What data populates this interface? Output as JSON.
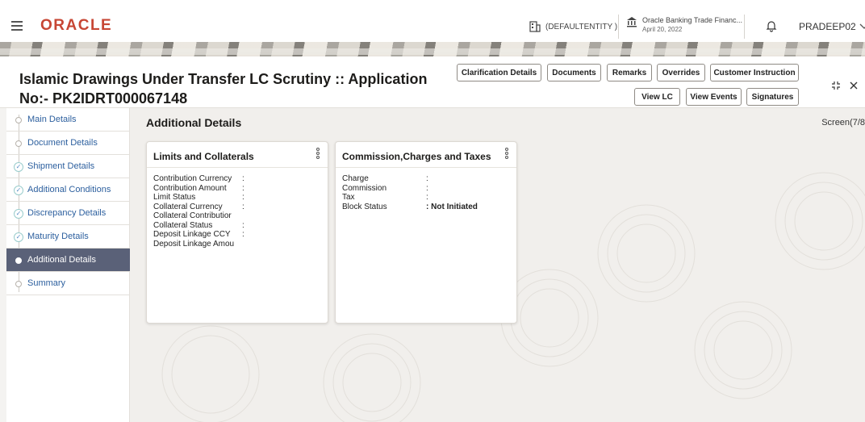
{
  "header": {
    "logo": "ORACLE",
    "entity": "(DEFAULTENTITY )",
    "bank_name": "Oracle Banking Trade Financ...",
    "bank_date": "April 20, 2022",
    "user": "PRADEEP02",
    "brand_color": "#c74634"
  },
  "title": {
    "line1": "Islamic Drawings Under Transfer LC Scrutiny :: Application",
    "line2": "No:- PK2IDRT000067148"
  },
  "toolbar": {
    "clarification": "Clarification Details",
    "documents": "Documents",
    "remarks": "Remarks",
    "overrides": "Overrides",
    "customer_instruction": "Customer Instruction",
    "view_lc": "View LC",
    "view_events": "View Events",
    "signatures": "Signatures"
  },
  "sidebar": {
    "items": [
      {
        "label": "Main Details",
        "state": "pending"
      },
      {
        "label": "Document Details",
        "state": "pending"
      },
      {
        "label": "Shipment Details",
        "state": "done"
      },
      {
        "label": "Additional Conditions",
        "state": "done"
      },
      {
        "label": "Discrepancy Details",
        "state": "done"
      },
      {
        "label": "Maturity Details",
        "state": "done"
      },
      {
        "label": "Additional Details",
        "state": "active"
      },
      {
        "label": "Summary",
        "state": "pending"
      }
    ]
  },
  "main": {
    "section_title": "Additional Details",
    "screen": "Screen(7/8"
  },
  "limits_card": {
    "title": "Limits and Collaterals",
    "rows": [
      {
        "label": "Contribution Currency",
        "sep": ":",
        "value": ""
      },
      {
        "label": "Contribution Amount",
        "sep": ":",
        "value": ""
      },
      {
        "label": "Limit Status",
        "sep": ":",
        "value": ""
      },
      {
        "label": "Collateral Currency",
        "sep": ":",
        "value": ""
      },
      {
        "label": "Collateral Contributior",
        "sep": "",
        "value": ""
      },
      {
        "label": "Collateral Status",
        "sep": ":",
        "value": ""
      },
      {
        "label": "Deposit Linkage CCY",
        "sep": ":",
        "value": ""
      },
      {
        "label": "Deposit Linkage Amou",
        "sep": "",
        "value": ""
      }
    ]
  },
  "commission_card": {
    "title": "Commission,Charges and Taxes",
    "rows": [
      {
        "label": "Charge",
        "sep": ":",
        "value": ""
      },
      {
        "label": "Commission",
        "sep": ":",
        "value": ""
      },
      {
        "label": "Tax",
        "sep": ":",
        "value": ""
      },
      {
        "label": "Block Status",
        "sep": ":",
        "value": "Not Initiated"
      }
    ]
  }
}
